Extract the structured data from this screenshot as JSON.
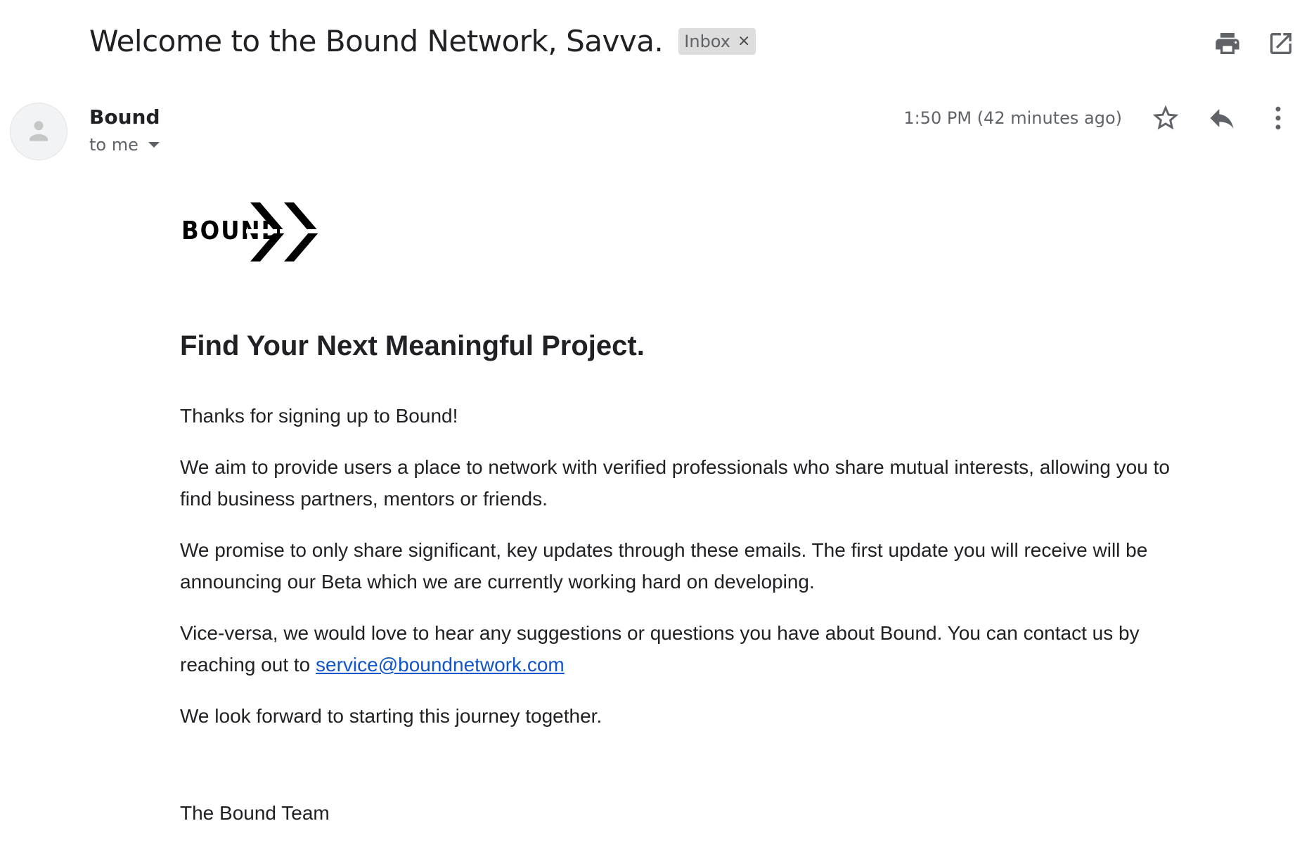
{
  "email": {
    "subject": "Welcome to the Bound Network, Savva.",
    "label": "Inbox",
    "label_remove": "×",
    "sender": "Bound",
    "recipient": "to me",
    "timestamp": "1:50 PM (42 minutes ago)"
  },
  "icons": {
    "print": "print-icon",
    "open_new_window": "open-in-new-window-icon",
    "star": "star-icon",
    "reply": "reply-icon",
    "more": "more-vertical-icon",
    "avatar": "person-avatar-icon",
    "dropdown": "chevron-down-icon"
  },
  "content": {
    "logo_text": "BOUND",
    "headline": "Find Your Next Meaningful Project.",
    "p1": "Thanks for signing up to Bound!",
    "p2": "We aim to provide users a place to network with verified professionals who share mutual interests, allowing you to find business partners, mentors or friends.",
    "p3": "We promise to only share significant, key updates through these emails. The first update you will receive will be announcing our Beta which we are currently working hard on developing.",
    "p4_prefix": "Vice-versa, we would love to hear any suggestions or questions you have about Bound. You can contact us by reaching out to ",
    "p4_link": "service@boundnetwork.com",
    "p5": "We look forward to starting this journey together.",
    "signoff": "The Bound Team"
  },
  "colors": {
    "link": "#1155cc",
    "text": "#202124",
    "muted": "#5f6368",
    "chip_bg": "#dddddd"
  }
}
